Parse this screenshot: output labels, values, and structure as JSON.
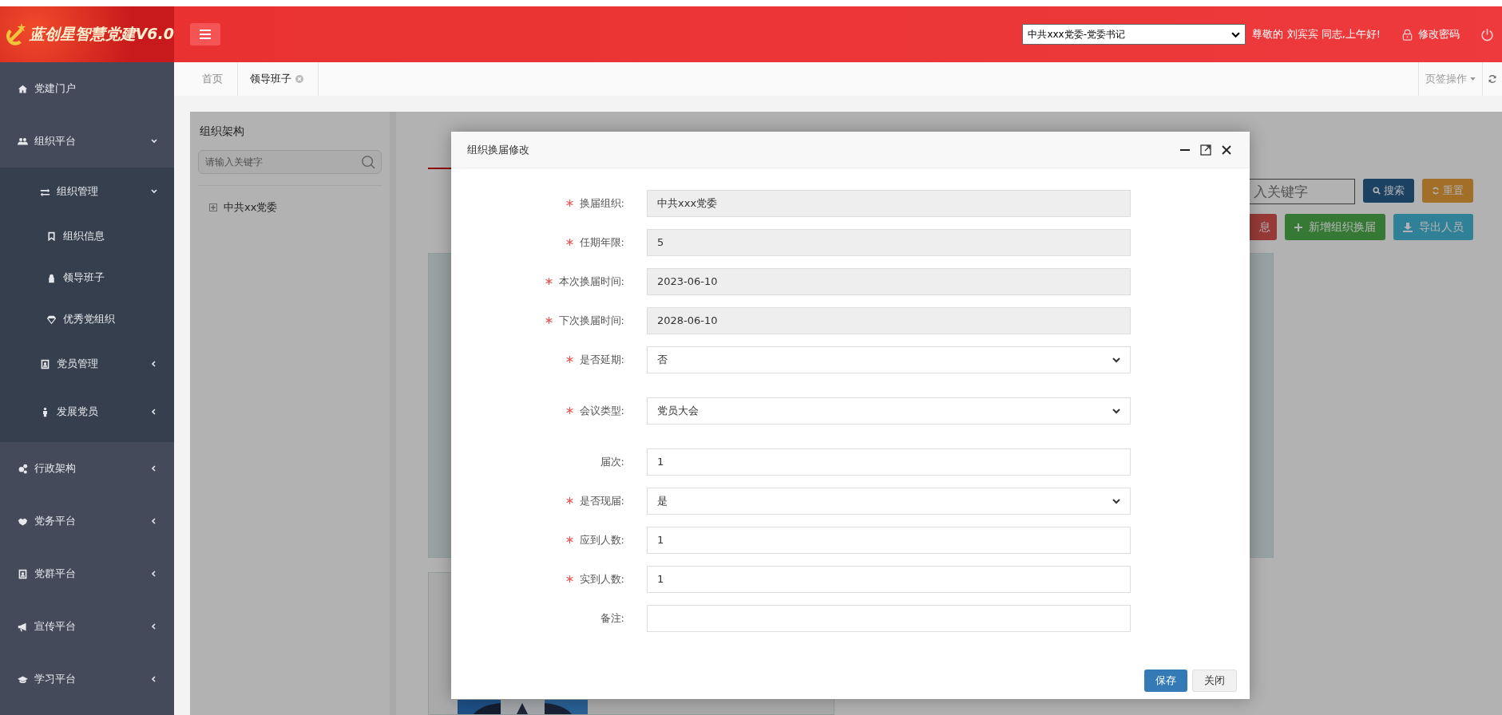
{
  "header": {
    "logo_text": "蓝创星智慧党建V6.0",
    "role_select": {
      "value": "中共xxx党委-党委书记"
    },
    "greeting": "尊敬的 刘宾宾 同志,上午好!",
    "change_password": "修改密码"
  },
  "tabs": [
    {
      "label": "首页",
      "selected": false,
      "closable": false
    },
    {
      "label": "领导班子",
      "selected": true,
      "closable": true
    }
  ],
  "tab_actions": "页签操作",
  "sidebar": {
    "items": [
      {
        "label": "党建门户"
      },
      {
        "label": "组织平台",
        "expanded": true,
        "children": [
          {
            "label": "组织管理",
            "expanded": true,
            "children": [
              {
                "label": "组织信息"
              },
              {
                "label": "领导班子"
              },
              {
                "label": "优秀党组织"
              }
            ]
          },
          {
            "label": "党员管理",
            "expanded": false
          },
          {
            "label": "发展党员",
            "expanded": false
          }
        ]
      },
      {
        "label": "行政架构",
        "expanded": false
      },
      {
        "label": "党务平台",
        "expanded": false
      },
      {
        "label": "党群平台",
        "expanded": false
      },
      {
        "label": "宣传平台",
        "expanded": false
      },
      {
        "label": "学习平台",
        "expanded": false
      }
    ]
  },
  "org_panel": {
    "title": "组织架构",
    "search": {
      "placeholder": "请输入关键字"
    },
    "tree": [
      {
        "label": "中共xx党委",
        "expanded": false
      }
    ]
  },
  "toolbar": {
    "search": {
      "placeholder": "入关键字"
    },
    "buttons": [
      {
        "label": "搜索",
        "kind": "search"
      },
      {
        "label": "重置",
        "kind": "reset"
      }
    ],
    "actions": [
      {
        "label": "息",
        "kind": "danger"
      },
      {
        "label": "新增组织换届",
        "kind": "add"
      },
      {
        "label": "导出人员",
        "kind": "export"
      }
    ]
  },
  "modal": {
    "title": "组织换届修改",
    "fields": [
      {
        "label": "换届组织:",
        "required": true,
        "kind": "readonly",
        "value": "中共xxx党委"
      },
      {
        "label": "任期年限:",
        "required": true,
        "kind": "readonly",
        "value": "5"
      },
      {
        "label": "本次换届时间:",
        "required": true,
        "kind": "readonly",
        "value": "2023-06-10"
      },
      {
        "label": "下次换届时间:",
        "required": true,
        "kind": "readonly",
        "value": "2028-06-10"
      },
      {
        "label": "是否延期:",
        "required": true,
        "kind": "select",
        "value": "否"
      },
      {
        "label": "会议类型:",
        "required": true,
        "kind": "select",
        "value": "党员大会"
      },
      {
        "label": "届次:",
        "required": false,
        "kind": "input",
        "value": "1"
      },
      {
        "label": "是否现届:",
        "required": true,
        "kind": "select",
        "value": "是"
      },
      {
        "label": "应到人数:",
        "required": true,
        "kind": "input",
        "value": "1"
      },
      {
        "label": "实到人数:",
        "required": true,
        "kind": "input",
        "value": "1"
      },
      {
        "label": "备注:",
        "required": false,
        "kind": "input"
      }
    ],
    "buttons": [
      {
        "label": "保存",
        "kind": "primary"
      },
      {
        "label": "关闭",
        "kind": "default"
      }
    ]
  }
}
